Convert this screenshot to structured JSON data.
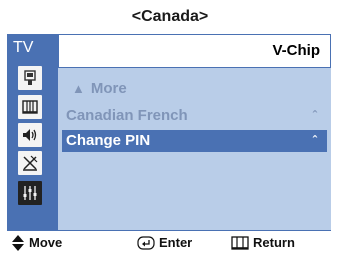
{
  "region_title": "<Canada>",
  "sidebar": {
    "label": "TV",
    "icons": [
      "input-icon",
      "channel-icon",
      "sound-icon",
      "antenna-icon",
      "setup-icon"
    ]
  },
  "panel": {
    "title": "V-Chip",
    "items": [
      {
        "label": "More",
        "arrow": "▲"
      },
      {
        "label": "Canadian French",
        "caret": "ˆ"
      },
      {
        "label": "Change PIN",
        "caret": "ˆ"
      }
    ]
  },
  "footer": {
    "move_label": "Move",
    "enter_label": "Enter",
    "return_label": "Return"
  }
}
